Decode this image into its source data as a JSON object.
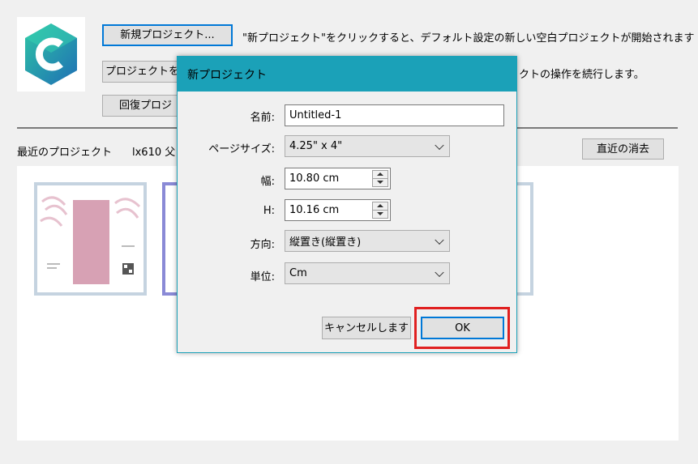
{
  "main": {
    "new_project_button": "新規プロジェクト...",
    "new_project_desc": "\"新プロジェクト\"をクリックすると、デフォルト設定の新しい空白プロジェクトが開始されます",
    "open_project_button": "プロジェクトを開",
    "open_project_desc": "クトの操作を続行します。",
    "restore_button": "回復プロジ",
    "recent_label": "最近のプロジェクト",
    "recent_sub": "lx610 父",
    "clear_recent_button": "直近の消去"
  },
  "dialog": {
    "title": "新プロジェクト",
    "name_label": "名前:",
    "name_value": "Untitled-1",
    "page_size_label": "ページサイズ:",
    "page_size_value": "4.25\" x 4\"",
    "width_label": "幅:",
    "width_value": "10.80 cm",
    "height_label": "H:",
    "height_value": "10.16 cm",
    "orientation_label": "方向:",
    "orientation_value": "縦置き(縦置き)",
    "unit_label": "単位:",
    "unit_value": "Cm",
    "cancel_button": "キャンセルします",
    "ok_button": "OK"
  },
  "colors": {
    "dialog_title_bar": "#1ba1b8",
    "highlight_box": "#e02020",
    "logo_teal": "#1fb5a7",
    "logo_blue": "#1f6fb5"
  },
  "icons": [
    "app-logo-icon",
    "chevron-down-icon",
    "spin-up-icon",
    "spin-down-icon"
  ]
}
